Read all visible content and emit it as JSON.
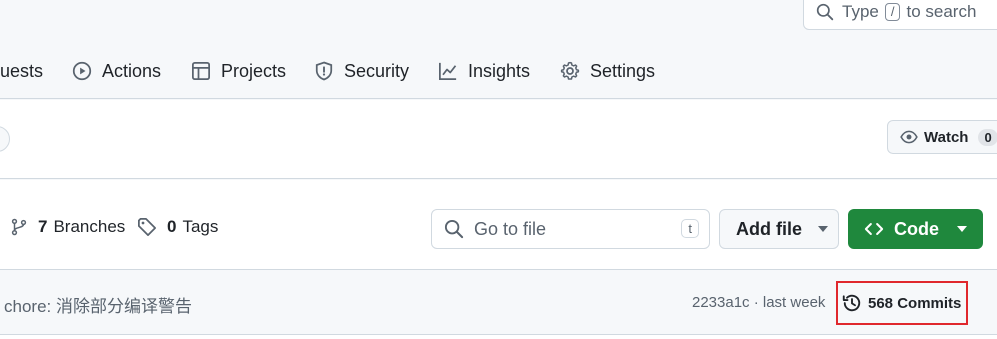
{
  "header": {
    "search": {
      "prefix": "Type",
      "key": "/",
      "suffix": "to search"
    }
  },
  "tabs": [
    {
      "label": "uests",
      "icon": "pull-request-icon"
    },
    {
      "label": "Actions",
      "icon": "play-icon"
    },
    {
      "label": "Projects",
      "icon": "table-icon"
    },
    {
      "label": "Security",
      "icon": "shield-icon"
    },
    {
      "label": "Insights",
      "icon": "graph-icon"
    },
    {
      "label": "Settings",
      "icon": "gear-icon"
    }
  ],
  "repo": {
    "watch": {
      "label": "Watch",
      "count": "0",
      "icon": "eye-icon"
    }
  },
  "toolbar": {
    "branches": {
      "count": "7",
      "label": "Branches",
      "icon": "git-branch-icon"
    },
    "tags": {
      "count": "0",
      "label": "Tags",
      "icon": "tag-icon"
    },
    "goto_file": {
      "placeholder": "Go to file",
      "shortcut": "t",
      "icon": "search-icon"
    },
    "add_file": {
      "label": "Add file"
    },
    "code": {
      "label": "Code",
      "icon": "code-icon"
    }
  },
  "latest_commit": {
    "message": "chore: 消除部分编译警告",
    "meta": "2233a1c · last week",
    "commits_label": "568 Commits",
    "icon": "history-icon"
  },
  "colors": {
    "accent_green": "#1f883d",
    "highlight_red": "#e0282d",
    "muted_text": "#59636e"
  }
}
